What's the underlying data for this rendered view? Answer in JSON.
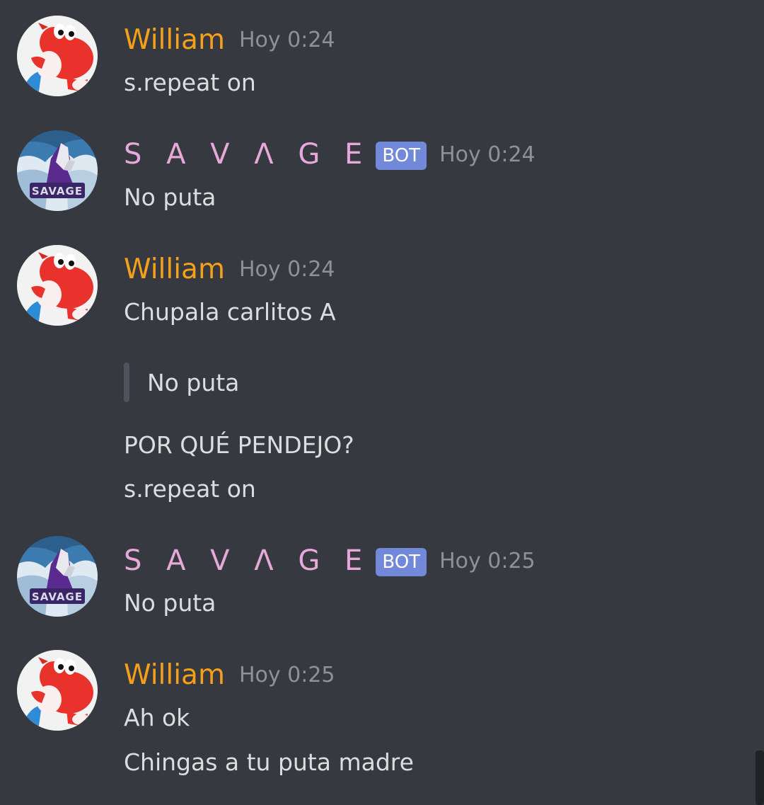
{
  "users": {
    "william": {
      "name": "William",
      "avatar_icon": "red-yoshi-avatar-icon",
      "color": "#f5a01a"
    },
    "savage": {
      "name": "S A V Λ G E",
      "badge": "BOT",
      "avatar_icon": "savage-wolf-logo-avatar-icon",
      "avatar_logo_text": "SAVAGE",
      "color": "#e6a9d9"
    }
  },
  "messages": [
    {
      "author": "William",
      "time": "Hoy 0:24",
      "lines": [
        "s.repeat on"
      ]
    },
    {
      "author": "S A V Λ G E",
      "badge": "BOT",
      "time": "Hoy 0:24",
      "lines": [
        "No puta"
      ]
    },
    {
      "author": "William",
      "time": "Hoy 0:24",
      "lines": [
        "Chupala carlitos A"
      ],
      "quote": "No puta",
      "after_quote": [
        "POR QUÉ PENDEJO?",
        "s.repeat on"
      ]
    },
    {
      "author": "S A V Λ G E",
      "badge": "BOT",
      "time": "Hoy 0:25",
      "lines": [
        "No puta"
      ]
    },
    {
      "author": "William",
      "time": "Hoy 0:25",
      "lines": [
        "Ah ok",
        "Chingas a tu puta madre"
      ]
    }
  ],
  "colors": {
    "background": "#36393f",
    "text": "#dcddde",
    "timestamp": "#8e9297",
    "bot_badge": "#7289da",
    "quote_bar": "#4f545c"
  }
}
